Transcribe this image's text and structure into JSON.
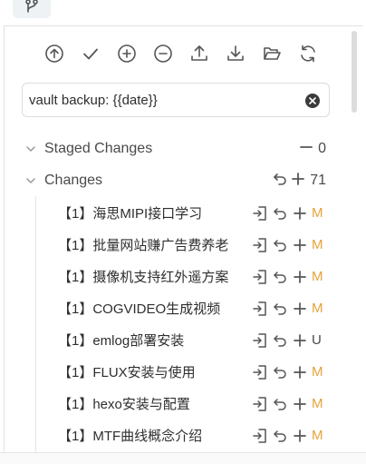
{
  "colors": {
    "modified": "#e6a23c",
    "untracked": "#4a4a4a",
    "icon": "#555555"
  },
  "toolbar": {
    "buttons": [
      {
        "name": "commit-and-sync-button",
        "icon": "arrow-up-circle-icon"
      },
      {
        "name": "commit-button",
        "icon": "check-icon"
      },
      {
        "name": "stage-all-button",
        "icon": "plus-circle-icon"
      },
      {
        "name": "unstage-all-button",
        "icon": "minus-circle-icon"
      },
      {
        "name": "push-button",
        "icon": "upload-icon"
      },
      {
        "name": "pull-button",
        "icon": "download-icon"
      },
      {
        "name": "change-layout-button",
        "icon": "folder-open-icon"
      },
      {
        "name": "refresh-button",
        "icon": "refresh-icon"
      }
    ]
  },
  "commit": {
    "message": "vault backup: {{date}}"
  },
  "staged": {
    "label": "Staged Changes",
    "count": "0"
  },
  "changes": {
    "label": "Changes",
    "count": "71",
    "files": [
      {
        "name": "【1】海思MIPI接口学习",
        "status": "M"
      },
      {
        "name": "【1】批量网站赚广告费养老",
        "status": "M"
      },
      {
        "name": "【1】摄像机支持红外遥方案",
        "status": "M"
      },
      {
        "name": "【1】COGVIDEO生成视频",
        "status": "M"
      },
      {
        "name": "【1】emlog部署安装",
        "status": "U"
      },
      {
        "name": "【1】FLUX安装与使用",
        "status": "M"
      },
      {
        "name": "【1】hexo安装与配置",
        "status": "M"
      },
      {
        "name": "【1】MTF曲线概念介绍",
        "status": "M"
      }
    ]
  }
}
